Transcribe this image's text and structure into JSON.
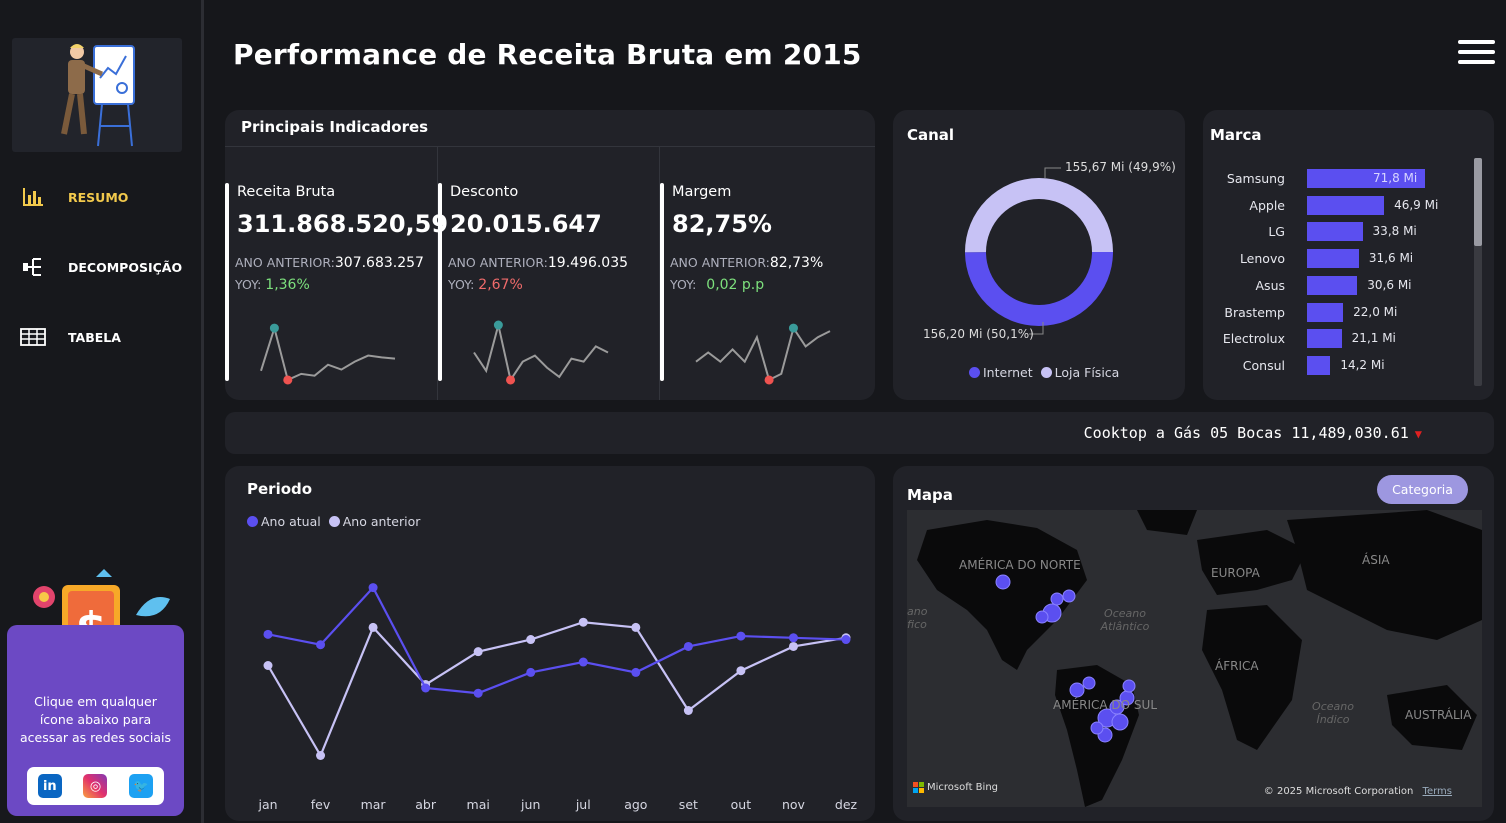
{
  "header": {
    "title": "Performance de Receita Bruta em 2015"
  },
  "nav": {
    "items": [
      {
        "label": "RESUMO",
        "icon": "bar-chart-icon",
        "active": true
      },
      {
        "label": "DECOMPOSIÇÃO",
        "icon": "decomposition-tree-icon",
        "active": false
      },
      {
        "label": "TABELA",
        "icon": "table-icon",
        "active": false
      }
    ]
  },
  "social": {
    "text_line1": "Clique em qualquer",
    "text_line2": "ícone abaixo para",
    "text_line3": "acessar as redes sociais",
    "links": [
      {
        "name": "linkedin",
        "glyph": "in",
        "color": "#0a66c2"
      },
      {
        "name": "instagram",
        "glyph": "◎",
        "color": "#e1306c"
      },
      {
        "name": "twitter",
        "glyph": "🐦",
        "color": "#1da1f2"
      }
    ]
  },
  "indicators": {
    "title": "Principais Indicadores",
    "kpis": [
      {
        "label": "Receita Bruta",
        "value": "311.868.520,59",
        "prev_label": "ANO ANTERIOR:",
        "prev_value": "307.683.257",
        "yoy_label": "YOY:",
        "yoy_value": "1,36%",
        "yoy_color": "#7de07d",
        "trend": [
          0.2,
          0.9,
          0.05,
          0.15,
          0.12,
          0.3,
          0.22,
          0.35,
          0.45,
          0.42,
          0.4
        ]
      },
      {
        "label": "Desconto",
        "value": "20.015.647",
        "prev_label": "ANO ANTERIOR:",
        "prev_value": "19.496.035",
        "yoy_label": "YOY:",
        "yoy_value": "2,67%",
        "yoy_color": "#ef6b6b",
        "trend": [
          0.5,
          0.2,
          0.95,
          0.05,
          0.35,
          0.45,
          0.25,
          0.1,
          0.4,
          0.35,
          0.6,
          0.5
        ]
      },
      {
        "label": "Margem",
        "value": "82,75%",
        "prev_label": "ANO ANTERIOR:",
        "prev_value": "82,73%",
        "yoy_label": "YOY:",
        "yoy_value": "0,02 p.p",
        "yoy_color": "#7de07d",
        "trend": [
          0.35,
          0.5,
          0.35,
          0.55,
          0.35,
          0.75,
          0.05,
          0.15,
          0.9,
          0.6,
          0.75,
          0.85
        ]
      }
    ]
  },
  "canal": {
    "title": "Canal",
    "label_internet": "155,67 Mi (49,9%)",
    "label_loja": "156,20 Mi (50,1%)",
    "legend": [
      {
        "name": "Internet",
        "color": "#5b4ff0"
      },
      {
        "name": "Loja Física",
        "color": "#c7c2f5"
      }
    ],
    "values": [
      155.67,
      156.2
    ]
  },
  "marca": {
    "title": "Marca",
    "items": [
      {
        "name": "Samsung",
        "value": 71.8,
        "label": "71,8 Mi"
      },
      {
        "name": "Apple",
        "value": 46.9,
        "label": "46,9 Mi"
      },
      {
        "name": "LG",
        "value": 33.8,
        "label": "33,8 Mi"
      },
      {
        "name": "Lenovo",
        "value": 31.6,
        "label": "31,6 Mi"
      },
      {
        "name": "Asus",
        "value": 30.6,
        "label": "30,6 Mi"
      },
      {
        "name": "Brastemp",
        "value": 22.0,
        "label": "22,0 Mi"
      },
      {
        "name": "Electrolux",
        "value": 21.1,
        "label": "21,1 Mi"
      },
      {
        "name": "Consul",
        "value": 14.2,
        "label": "14,2 Mi"
      }
    ]
  },
  "ticker": {
    "text": "Cooktop a Gás 05 Bocas 11,489,030.61",
    "arrow": "▼"
  },
  "periodo": {
    "title": "Periodo",
    "legend": [
      {
        "name": "Ano atual",
        "color": "#5b4ff0"
      },
      {
        "name": "Ano anterior",
        "color": "#c7c2f5"
      }
    ]
  },
  "chart_data": {
    "type": "line",
    "title": "Periodo",
    "categories": [
      "jan",
      "fev",
      "mar",
      "abr",
      "mai",
      "jun",
      "jul",
      "ago",
      "set",
      "out",
      "nov",
      "dez"
    ],
    "series": [
      {
        "name": "Ano atual",
        "color": "#5b4ff0",
        "values": [
          26.3,
          25.7,
          29.0,
          23.2,
          22.9,
          24.1,
          24.7,
          24.1,
          25.6,
          26.2,
          26.1,
          26.0
        ]
      },
      {
        "name": "Ano anterior",
        "color": "#c7c2f5",
        "values": [
          24.5,
          19.3,
          26.7,
          23.4,
          25.3,
          26.0,
          27.0,
          26.7,
          21.9,
          24.2,
          25.6,
          26.1
        ]
      }
    ],
    "ylim": [
      18,
      31
    ]
  },
  "mapa": {
    "title": "Mapa",
    "button": "Categoria",
    "labels": {
      "na": "AMÉRICA DO NORTE",
      "eu": "EUROPA",
      "as": "ÁSIA",
      "af": "ÁFRICA",
      "sa": "AMÉRICA DO SUL",
      "au": "AUSTRÁLIA",
      "atl": "Oceano Atlântico",
      "ind": "Oceano Índico",
      "pac": "ano fico"
    },
    "credit_left": "Microsoft Bing",
    "credit_right": "© 2025 Microsoft Corporation",
    "terms": "Terms"
  }
}
